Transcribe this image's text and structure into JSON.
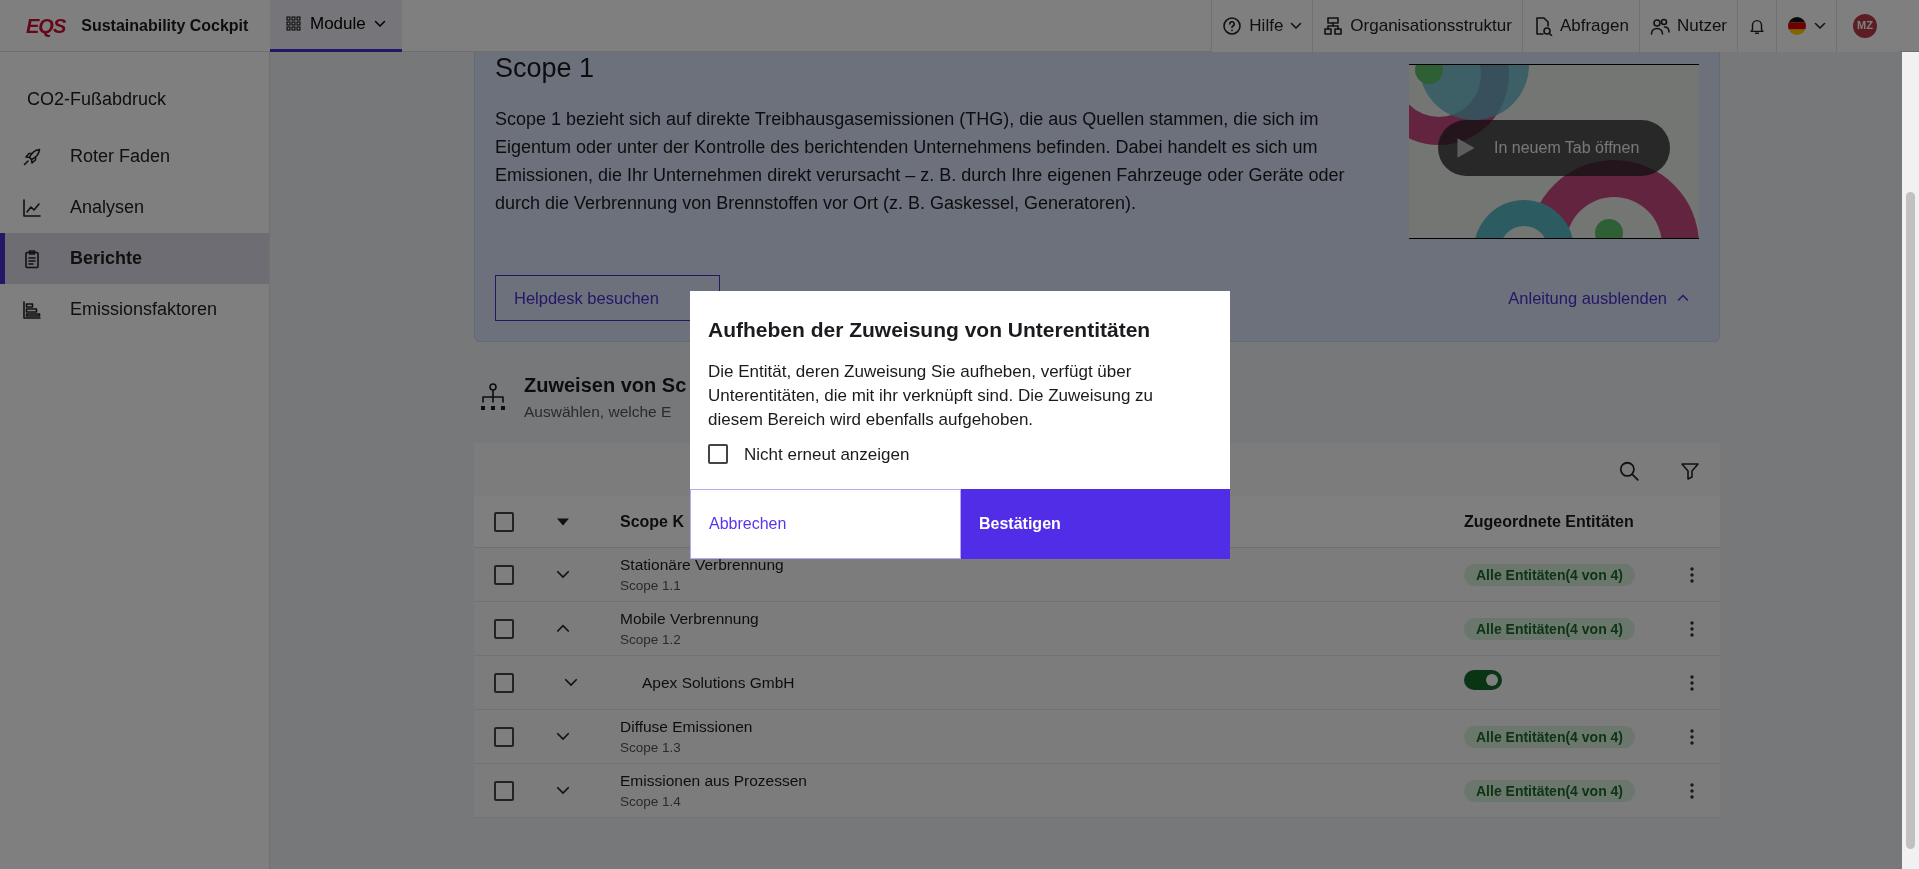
{
  "topbar": {
    "logo": "EQS",
    "app_title": "Sustainability Cockpit",
    "module_menu": {
      "label": "Module",
      "selected": true
    },
    "nav": [
      {
        "label": "Hilfe",
        "dropdown": true
      },
      {
        "label": "Organisationsstruktur",
        "dropdown": false
      },
      {
        "label": "Abfragen",
        "dropdown": false
      },
      {
        "label": "Nutzer",
        "dropdown": false
      }
    ],
    "avatar": "MZ"
  },
  "sidebar": {
    "title": "CO2-Fußabdruck",
    "items": [
      {
        "label": "Roter Faden",
        "selected": false
      },
      {
        "label": "Analysen",
        "selected": false
      },
      {
        "label": "Berichte",
        "selected": true
      },
      {
        "label": "Emissionsfaktoren",
        "selected": false
      }
    ]
  },
  "guide": {
    "title": "Scope 1",
    "text": "Scope 1 bezieht sich auf direkte Treibhausgasemissionen (THG), die aus Quellen stammen, die sich im Eigentum oder unter der Kontrolle des berichtenden Unternehmens befinden. Dabei handelt es sich um Emissionen, die Ihr Unternehmen direkt verursacht – z. B. durch Ihre eigenen Fahrzeuge oder Geräte oder durch die Verbrennung von Brennstoffen vor Ort (z. B. Gaskessel, Generatoren).",
    "video_button": "In neuem Tab öffnen",
    "helpdesk_button": "Helpdesk besuchen",
    "hide_link": "Anleitung ausblenden"
  },
  "section": {
    "title": "Zuweisen von Sc",
    "subtitle": "Auswählen, welche E"
  },
  "table": {
    "columns": [
      "Scope K",
      "Zugeordnete Entitäten"
    ],
    "select_all_checked": false,
    "rows": [
      {
        "kind": "scope",
        "name": "Stationäre Verbrennung",
        "code": "Scope 1.1",
        "checked": false,
        "expanded": false,
        "badge": "Alle Entitäten(4 von 4)"
      },
      {
        "kind": "scope",
        "name": "Mobile Verbrennung",
        "code": "Scope 1.2",
        "checked": false,
        "expanded": true,
        "badge": "Alle Entitäten(4 von 4)"
      },
      {
        "kind": "entity",
        "name": "Apex Solutions GmbH",
        "checked": false,
        "expanded": false,
        "on": true
      },
      {
        "kind": "scope",
        "name": "Diffuse Emissionen",
        "code": "Scope 1.3",
        "checked": false,
        "expanded": false,
        "badge": "Alle Entitäten(4 von 4)"
      },
      {
        "kind": "scope",
        "name": "Emissionen aus Prozessen",
        "code": "Scope 1.4",
        "checked": false,
        "expanded": false,
        "badge": "Alle Entitäten(4 von 4)"
      }
    ]
  },
  "dialog": {
    "title": "Aufheben der Zuweisung von Unterentitäten",
    "text": "Die Entität, deren Zuweisung Sie aufheben, verfügt über Unterentitäten, die mit ihr verknüpft sind. Die Zuweisung zu diesem Bereich wird ebenfalls aufgehoben.",
    "checkbox": {
      "label": "Nicht erneut anzeigen",
      "checked": false
    },
    "cancel": "Abbrechen",
    "confirm": "Bestätigen"
  }
}
